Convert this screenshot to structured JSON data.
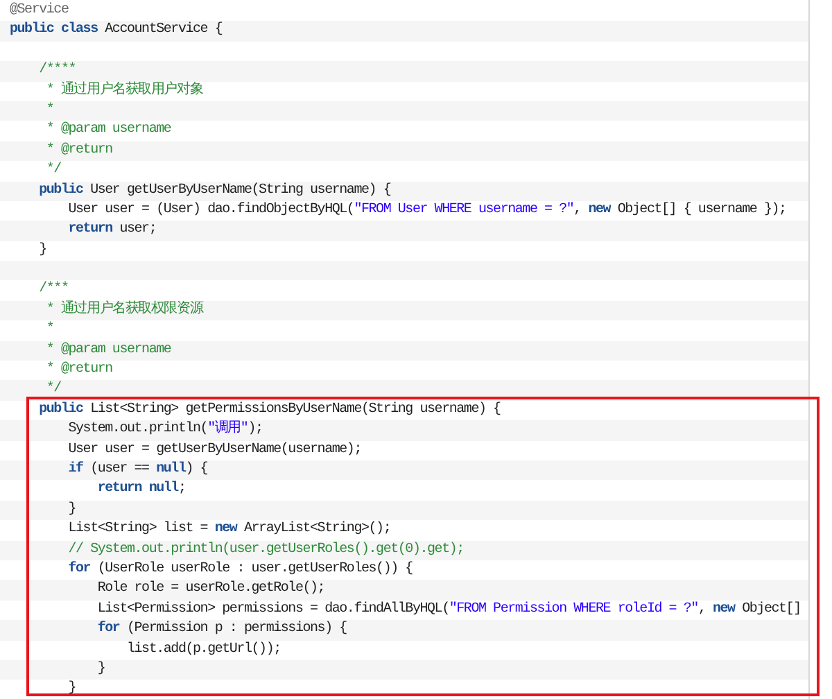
{
  "editor": {
    "lines": [
      {
        "kind": "code",
        "tokens": [
          {
            "kind": "annotation",
            "text": "@Service"
          }
        ]
      },
      {
        "kind": "code",
        "tokens": [
          {
            "kind": "keyword",
            "text": "public class"
          },
          {
            "kind": "plain",
            "text": " AccountService {"
          }
        ]
      },
      {
        "kind": "blank"
      },
      {
        "kind": "code",
        "tokens": [
          {
            "kind": "comment",
            "text": "    /****"
          }
        ]
      },
      {
        "kind": "code",
        "tokens": [
          {
            "kind": "comment",
            "text": "     * 通过用户名获取用户对象"
          }
        ]
      },
      {
        "kind": "code",
        "tokens": [
          {
            "kind": "comment",
            "text": "     *"
          }
        ]
      },
      {
        "kind": "code",
        "tokens": [
          {
            "kind": "comment",
            "text": "     * @param username"
          }
        ]
      },
      {
        "kind": "code",
        "tokens": [
          {
            "kind": "comment",
            "text": "     * @return"
          }
        ]
      },
      {
        "kind": "code",
        "tokens": [
          {
            "kind": "comment",
            "text": "     */"
          }
        ]
      },
      {
        "kind": "code",
        "tokens": [
          {
            "kind": "keyword",
            "text": "    public"
          },
          {
            "kind": "plain",
            "text": " User getUserByUserName(String username) {"
          }
        ]
      },
      {
        "kind": "code",
        "tokens": [
          {
            "kind": "plain",
            "text": "        User user = (User) dao.findObjectByHQL("
          },
          {
            "kind": "string",
            "text": "\"FROM User WHERE username = ?\""
          },
          {
            "kind": "plain",
            "text": ", "
          },
          {
            "kind": "keyword",
            "text": "new"
          },
          {
            "kind": "plain",
            "text": " Object[] { username });"
          }
        ]
      },
      {
        "kind": "code",
        "tokens": [
          {
            "kind": "keyword",
            "text": "        return"
          },
          {
            "kind": "plain",
            "text": " user;"
          }
        ]
      },
      {
        "kind": "code",
        "tokens": [
          {
            "kind": "plain",
            "text": "    }"
          }
        ]
      },
      {
        "kind": "blank"
      },
      {
        "kind": "code",
        "tokens": [
          {
            "kind": "comment",
            "text": "    /***"
          }
        ]
      },
      {
        "kind": "code",
        "tokens": [
          {
            "kind": "comment",
            "text": "     * 通过用户名获取权限资源"
          }
        ]
      },
      {
        "kind": "code",
        "tokens": [
          {
            "kind": "comment",
            "text": "     *"
          }
        ]
      },
      {
        "kind": "code",
        "tokens": [
          {
            "kind": "comment",
            "text": "     * @param username"
          }
        ]
      },
      {
        "kind": "code",
        "tokens": [
          {
            "kind": "comment",
            "text": "     * @return"
          }
        ]
      },
      {
        "kind": "code",
        "tokens": [
          {
            "kind": "comment",
            "text": "     */"
          }
        ]
      }
    ],
    "highlighted_block": {
      "lines": [
        {
          "kind": "code",
          "tokens": [
            {
              "kind": "keyword",
              "text": "    public"
            },
            {
              "kind": "plain",
              "text": " List<String> getPermissionsByUserName(String username) {"
            }
          ]
        },
        {
          "kind": "code",
          "tokens": [
            {
              "kind": "plain",
              "text": "        System.out.println("
            },
            {
              "kind": "string",
              "text": "\"调用\""
            },
            {
              "kind": "plain",
              "text": ");"
            }
          ]
        },
        {
          "kind": "code",
          "tokens": [
            {
              "kind": "plain",
              "text": "        User user = getUserByUserName(username);"
            }
          ]
        },
        {
          "kind": "code",
          "tokens": [
            {
              "kind": "keyword",
              "text": "        if"
            },
            {
              "kind": "plain",
              "text": " (user == "
            },
            {
              "kind": "keyword",
              "text": "null"
            },
            {
              "kind": "plain",
              "text": ") {"
            }
          ]
        },
        {
          "kind": "code",
          "tokens": [
            {
              "kind": "keyword",
              "text": "            return null"
            },
            {
              "kind": "plain",
              "text": ";"
            }
          ]
        },
        {
          "kind": "code",
          "tokens": [
            {
              "kind": "plain",
              "text": "        }"
            }
          ]
        },
        {
          "kind": "code",
          "tokens": [
            {
              "kind": "plain",
              "text": "        List<String> list = "
            },
            {
              "kind": "keyword",
              "text": "new"
            },
            {
              "kind": "plain",
              "text": " ArrayList<String>();"
            }
          ]
        },
        {
          "kind": "code",
          "tokens": [
            {
              "kind": "comment",
              "text": "        // System.out.println(user.getUserRoles().get(0).get);"
            }
          ]
        },
        {
          "kind": "code",
          "tokens": [
            {
              "kind": "keyword",
              "text": "        for"
            },
            {
              "kind": "plain",
              "text": " (UserRole userRole : user.getUserRoles()) {"
            }
          ]
        },
        {
          "kind": "code",
          "tokens": [
            {
              "kind": "plain",
              "text": "            Role role = userRole.getRole();"
            }
          ]
        },
        {
          "kind": "code",
          "tokens": [
            {
              "kind": "plain",
              "text": "            List<Permission> permissions = dao.findAllByHQL("
            },
            {
              "kind": "string",
              "text": "\"FROM Permission WHERE roleId = ?\""
            },
            {
              "kind": "plain",
              "text": ", "
            },
            {
              "kind": "keyword",
              "text": "new"
            },
            {
              "kind": "plain",
              "text": " Object[]"
            }
          ]
        },
        {
          "kind": "code",
          "tokens": [
            {
              "kind": "keyword",
              "text": "            for"
            },
            {
              "kind": "plain",
              "text": " (Permission p : permissions) {"
            }
          ]
        },
        {
          "kind": "code",
          "tokens": [
            {
              "kind": "plain",
              "text": "                list.add(p.getUrl());"
            }
          ]
        },
        {
          "kind": "code",
          "tokens": [
            {
              "kind": "plain",
              "text": "            }"
            }
          ]
        },
        {
          "kind": "code",
          "tokens": [
            {
              "kind": "plain",
              "text": "        }"
            }
          ]
        }
      ]
    }
  }
}
